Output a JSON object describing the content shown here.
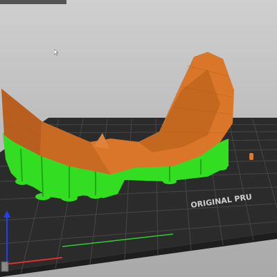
{
  "viewport": {
    "bed_label": "ORIGINAL PRU",
    "colors": {
      "background_top": "#cfcfcf",
      "background_bottom": "#a9a9a9",
      "bed": "#2b2b2b",
      "grid": "#4a4a4a",
      "model": "#d9762a",
      "model_shade": "#b85f1f",
      "supports": "#33dd22",
      "axis_x": "#e03030",
      "axis_y": "#30d030",
      "axis_z": "#2040ff"
    },
    "icons": [
      "mouse-cursor-icon",
      "axis-gizmo-icon"
    ]
  }
}
